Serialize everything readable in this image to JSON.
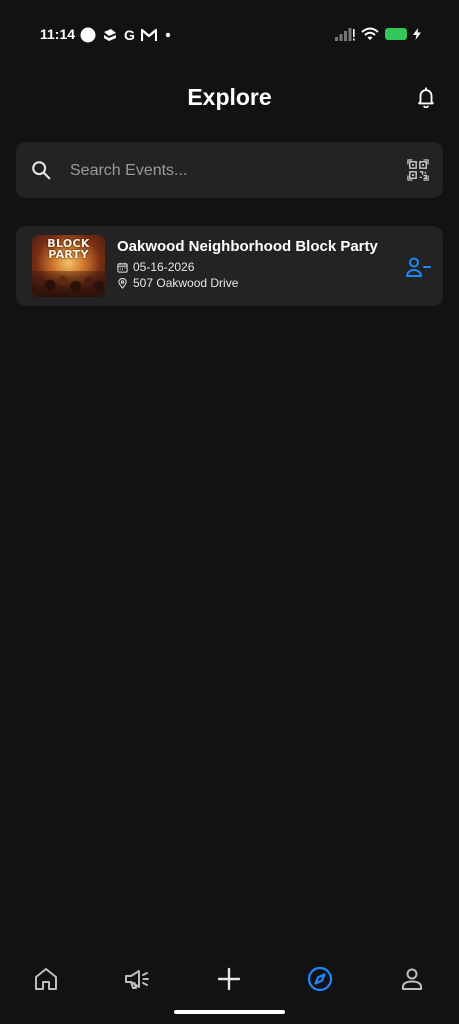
{
  "status_bar": {
    "time": "11:14",
    "left_icons": [
      "circle-icon",
      "notes-icon",
      "google-icon",
      "gmail-icon",
      "dot-icon"
    ],
    "google_letter": "G",
    "right_icons": [
      "signal-icon",
      "wifi-icon",
      "battery-charging-icon"
    ]
  },
  "header": {
    "title": "Explore",
    "notification_icon": "bell-icon"
  },
  "search": {
    "placeholder": "Search Events...",
    "value": "",
    "icon": "search-icon",
    "scan_icon": "qr-scan-icon"
  },
  "events": [
    {
      "thumbnail_text": "BLOCK PARTY",
      "title": "Oakwood Neighborhood Block Party",
      "date": "05-16-2026",
      "location": "507 Oakwood Drive",
      "action_icon": "user-minus-icon"
    }
  ],
  "bottom_nav": {
    "items": [
      {
        "name": "home",
        "icon": "home-icon",
        "active": false
      },
      {
        "name": "announcements",
        "icon": "megaphone-icon",
        "active": false
      },
      {
        "name": "create",
        "icon": "plus-icon",
        "active": false
      },
      {
        "name": "explore",
        "icon": "compass-icon",
        "active": true
      },
      {
        "name": "profile",
        "icon": "person-icon",
        "active": false
      }
    ]
  },
  "colors": {
    "background": "#121212",
    "card": "#232323",
    "accent": "#1e88ff",
    "text": "#ffffff",
    "muted": "#9a9a9a",
    "battery": "#34c759"
  }
}
